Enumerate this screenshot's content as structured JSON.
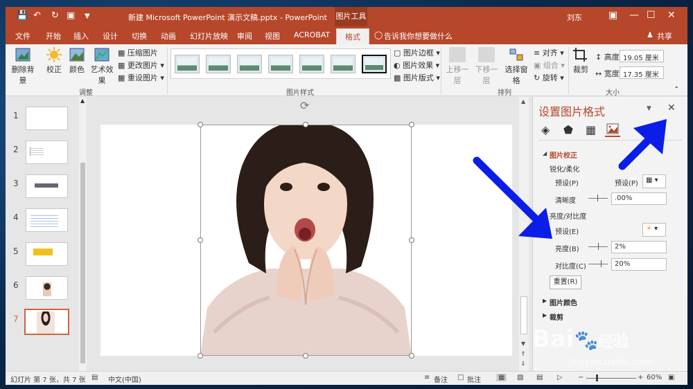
{
  "app": {
    "title": "新建 Microsoft PowerPoint 演示文稿.pptx  -  PowerPoint",
    "context_tab": "图片工具",
    "user": "刘东"
  },
  "tabs": [
    "文件",
    "开始",
    "插入",
    "设计",
    "切换",
    "动画",
    "幻灯片放映",
    "审阅",
    "视图",
    "ACROBAT",
    "格式"
  ],
  "tell_me": "告诉我你想要做什么",
  "share": "共享",
  "ribbon": {
    "remove_bg": "删除背景",
    "corrections": "校正",
    "color": "颜色",
    "artistic": "艺术效果",
    "compress": "压缩图片",
    "change": "更改图片",
    "reset": "重设图片",
    "group_adjust": "调整",
    "group_styles": "图片样式",
    "border": "图片边框",
    "effects": "图片效果",
    "layout": "图片版式",
    "bring_forward": "上移一层",
    "send_backward": "下移一层",
    "selection_pane": "选择窗格",
    "align": "对齐",
    "group": "组合",
    "rotate": "旋转",
    "group_arrange": "排列",
    "crop": "裁剪",
    "height_label": "高度:",
    "height_value": "19.05 厘米",
    "width_label": "宽度:",
    "width_value": "17.35 厘米",
    "group_size": "大小"
  },
  "slides": [
    {
      "num": "1"
    },
    {
      "num": "2"
    },
    {
      "num": "3"
    },
    {
      "num": "4"
    },
    {
      "num": "5"
    },
    {
      "num": "6"
    },
    {
      "num": "7",
      "selected": true
    }
  ],
  "pane": {
    "title": "设置图片格式",
    "section_correction": "图片校正",
    "sharpen_soften": "锐化/柔化",
    "preset1": "预设(P)",
    "preset2": "预设(P)",
    "clarity_label": "清晰度",
    "clarity_value": ".00%",
    "brightness_contrast": "亮度/对比度",
    "preset_e": "预设(E)",
    "brightness_label": "亮度(B)",
    "brightness_value": "2%",
    "contrast_label": "对比度(C)",
    "contrast_value": "20%",
    "reset_btn": "重置(R)",
    "section_color": "图片颜色",
    "section_crop": "裁剪"
  },
  "status": {
    "slide_info": "幻灯片 第 7 张，共 7 张",
    "language": "中文(中国)",
    "notes": "备注",
    "comments": "批注",
    "zoom": "60%"
  },
  "watermark": {
    "brand": "Bai",
    "brand_cn": "经验",
    "url": "jingyan.baidu.com"
  },
  "colors": {
    "accent": "#b7472a",
    "arrow": "#0a1ee8",
    "selected_slide_border": "#d0643e"
  }
}
